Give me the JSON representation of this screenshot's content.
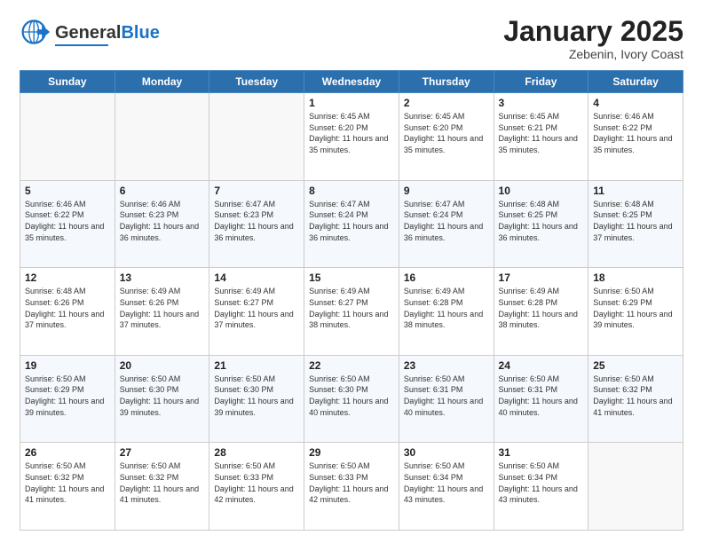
{
  "header": {
    "logo_general": "General",
    "logo_blue": "Blue",
    "title": "January 2025",
    "subtitle": "Zebenin, Ivory Coast"
  },
  "days_of_week": [
    "Sunday",
    "Monday",
    "Tuesday",
    "Wednesday",
    "Thursday",
    "Friday",
    "Saturday"
  ],
  "weeks": [
    [
      {
        "day": "",
        "info": ""
      },
      {
        "day": "",
        "info": ""
      },
      {
        "day": "",
        "info": ""
      },
      {
        "day": "1",
        "info": "Sunrise: 6:45 AM\nSunset: 6:20 PM\nDaylight: 11 hours\nand 35 minutes."
      },
      {
        "day": "2",
        "info": "Sunrise: 6:45 AM\nSunset: 6:20 PM\nDaylight: 11 hours\nand 35 minutes."
      },
      {
        "day": "3",
        "info": "Sunrise: 6:45 AM\nSunset: 6:21 PM\nDaylight: 11 hours\nand 35 minutes."
      },
      {
        "day": "4",
        "info": "Sunrise: 6:46 AM\nSunset: 6:22 PM\nDaylight: 11 hours\nand 35 minutes."
      }
    ],
    [
      {
        "day": "5",
        "info": "Sunrise: 6:46 AM\nSunset: 6:22 PM\nDaylight: 11 hours\nand 35 minutes."
      },
      {
        "day": "6",
        "info": "Sunrise: 6:46 AM\nSunset: 6:23 PM\nDaylight: 11 hours\nand 36 minutes."
      },
      {
        "day": "7",
        "info": "Sunrise: 6:47 AM\nSunset: 6:23 PM\nDaylight: 11 hours\nand 36 minutes."
      },
      {
        "day": "8",
        "info": "Sunrise: 6:47 AM\nSunset: 6:24 PM\nDaylight: 11 hours\nand 36 minutes."
      },
      {
        "day": "9",
        "info": "Sunrise: 6:47 AM\nSunset: 6:24 PM\nDaylight: 11 hours\nand 36 minutes."
      },
      {
        "day": "10",
        "info": "Sunrise: 6:48 AM\nSunset: 6:25 PM\nDaylight: 11 hours\nand 36 minutes."
      },
      {
        "day": "11",
        "info": "Sunrise: 6:48 AM\nSunset: 6:25 PM\nDaylight: 11 hours\nand 37 minutes."
      }
    ],
    [
      {
        "day": "12",
        "info": "Sunrise: 6:48 AM\nSunset: 6:26 PM\nDaylight: 11 hours\nand 37 minutes."
      },
      {
        "day": "13",
        "info": "Sunrise: 6:49 AM\nSunset: 6:26 PM\nDaylight: 11 hours\nand 37 minutes."
      },
      {
        "day": "14",
        "info": "Sunrise: 6:49 AM\nSunset: 6:27 PM\nDaylight: 11 hours\nand 37 minutes."
      },
      {
        "day": "15",
        "info": "Sunrise: 6:49 AM\nSunset: 6:27 PM\nDaylight: 11 hours\nand 38 minutes."
      },
      {
        "day": "16",
        "info": "Sunrise: 6:49 AM\nSunset: 6:28 PM\nDaylight: 11 hours\nand 38 minutes."
      },
      {
        "day": "17",
        "info": "Sunrise: 6:49 AM\nSunset: 6:28 PM\nDaylight: 11 hours\nand 38 minutes."
      },
      {
        "day": "18",
        "info": "Sunrise: 6:50 AM\nSunset: 6:29 PM\nDaylight: 11 hours\nand 39 minutes."
      }
    ],
    [
      {
        "day": "19",
        "info": "Sunrise: 6:50 AM\nSunset: 6:29 PM\nDaylight: 11 hours\nand 39 minutes."
      },
      {
        "day": "20",
        "info": "Sunrise: 6:50 AM\nSunset: 6:30 PM\nDaylight: 11 hours\nand 39 minutes."
      },
      {
        "day": "21",
        "info": "Sunrise: 6:50 AM\nSunset: 6:30 PM\nDaylight: 11 hours\nand 39 minutes."
      },
      {
        "day": "22",
        "info": "Sunrise: 6:50 AM\nSunset: 6:30 PM\nDaylight: 11 hours\nand 40 minutes."
      },
      {
        "day": "23",
        "info": "Sunrise: 6:50 AM\nSunset: 6:31 PM\nDaylight: 11 hours\nand 40 minutes."
      },
      {
        "day": "24",
        "info": "Sunrise: 6:50 AM\nSunset: 6:31 PM\nDaylight: 11 hours\nand 40 minutes."
      },
      {
        "day": "25",
        "info": "Sunrise: 6:50 AM\nSunset: 6:32 PM\nDaylight: 11 hours\nand 41 minutes."
      }
    ],
    [
      {
        "day": "26",
        "info": "Sunrise: 6:50 AM\nSunset: 6:32 PM\nDaylight: 11 hours\nand 41 minutes."
      },
      {
        "day": "27",
        "info": "Sunrise: 6:50 AM\nSunset: 6:32 PM\nDaylight: 11 hours\nand 41 minutes."
      },
      {
        "day": "28",
        "info": "Sunrise: 6:50 AM\nSunset: 6:33 PM\nDaylight: 11 hours\nand 42 minutes."
      },
      {
        "day": "29",
        "info": "Sunrise: 6:50 AM\nSunset: 6:33 PM\nDaylight: 11 hours\nand 42 minutes."
      },
      {
        "day": "30",
        "info": "Sunrise: 6:50 AM\nSunset: 6:34 PM\nDaylight: 11 hours\nand 43 minutes."
      },
      {
        "day": "31",
        "info": "Sunrise: 6:50 AM\nSunset: 6:34 PM\nDaylight: 11 hours\nand 43 minutes."
      },
      {
        "day": "",
        "info": ""
      }
    ]
  ]
}
